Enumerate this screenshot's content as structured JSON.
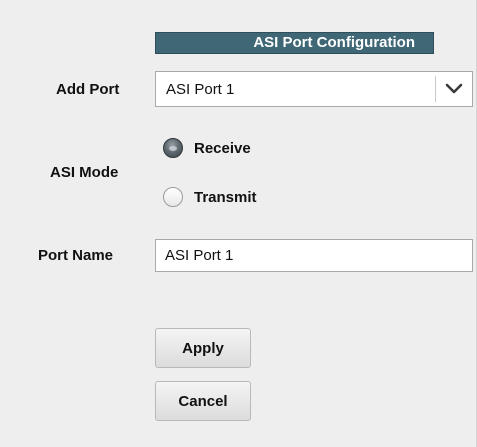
{
  "section": {
    "title": "ASI Port Configuration"
  },
  "add_port": {
    "label": "Add Port",
    "selected": "ASI Port 1",
    "dropdown_icon": "chevron-down-icon"
  },
  "asi_mode": {
    "label": "ASI Mode",
    "options": [
      {
        "label": "Receive",
        "checked": true
      },
      {
        "label": "Transmit",
        "checked": false
      }
    ]
  },
  "port_name": {
    "label": "Port Name",
    "value": "ASI Port 1"
  },
  "buttons": {
    "apply": "Apply",
    "cancel": "Cancel"
  },
  "colors": {
    "header_bg": "#3f6776",
    "panel_bg": "#eeeeee"
  }
}
